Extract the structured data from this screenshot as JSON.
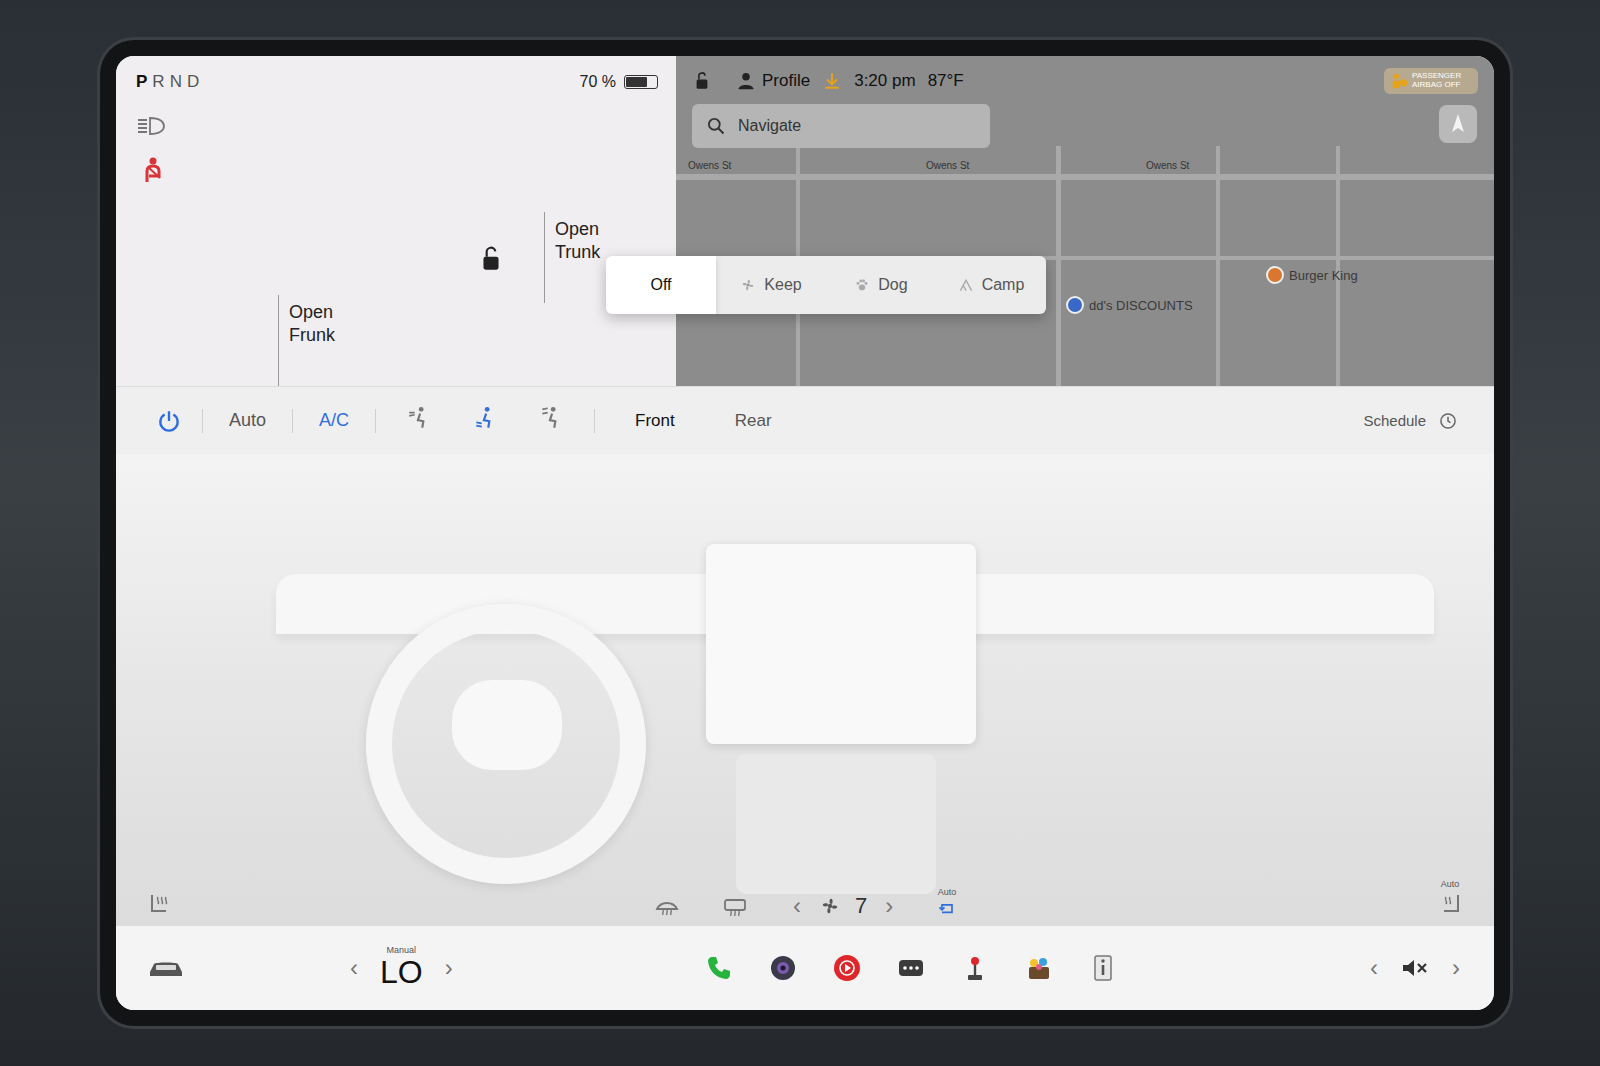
{
  "status_bar": {
    "gears": [
      {
        "label": "P",
        "selected": true
      },
      {
        "label": "R",
        "selected": false
      },
      {
        "label": "N",
        "selected": false
      },
      {
        "label": "D",
        "selected": false
      }
    ],
    "battery": {
      "reading": "70 %",
      "level": 0.7
    },
    "profile": "Profile",
    "time": "3:20 pm",
    "temperature": "87°F",
    "airbag": "PASSENGER AIRBAG OFF",
    "update_pending": true
  },
  "car_panel": {
    "frunk": "Open Frunk",
    "trunk": "Open Trunk",
    "locked": false,
    "seatbelt_warning": true
  },
  "map": {
    "search": {
      "placeholder": "Navigate"
    },
    "streets": [
      "Owens St",
      "Owens St",
      "Owens St"
    ],
    "places": [
      {
        "name": "dd's DISCOUNTS",
        "color": "#3a68c9"
      },
      {
        "name": "Burger King",
        "color": "#d9772f"
      }
    ]
  },
  "climate_keeper": {
    "options": [
      {
        "label": "Off",
        "selected": true
      },
      {
        "label": "Keep",
        "selected": false
      },
      {
        "label": "Dog",
        "selected": false
      },
      {
        "label": "Camp",
        "selected": false
      }
    ]
  },
  "climate": {
    "power": true,
    "auto": {
      "label": "Auto",
      "on": false
    },
    "ac": {
      "label": "A/C",
      "on": true
    },
    "airflow": [
      {
        "kind": "face",
        "on": false
      },
      {
        "kind": "feet",
        "on": true
      },
      {
        "kind": "defrost",
        "on": false
      }
    ],
    "zones": [
      {
        "label": "Front",
        "selected": true
      },
      {
        "label": "Rear",
        "selected": false
      }
    ],
    "schedule": "Schedule",
    "fan": {
      "speed": "7",
      "left": "‹",
      "right": "›"
    },
    "recirculate": {
      "label": "Auto",
      "on": true
    },
    "seat_heat_right": {
      "label": "Auto"
    }
  },
  "dock": {
    "temperature": {
      "mode": "Manual",
      "value": "LO",
      "left": "‹",
      "right": "›"
    },
    "volume": {
      "muted": true,
      "left": "‹",
      "right": "›"
    }
  }
}
